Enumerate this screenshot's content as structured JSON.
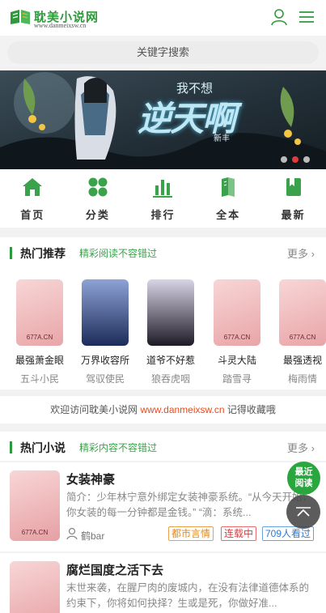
{
  "header": {
    "logo_title": "耽美小说网",
    "logo_url": "www.danmeixsw.cn",
    "user_icon": "user-icon",
    "menu_icon": "menu-icon"
  },
  "search": {
    "placeholder": "关键字搜索"
  },
  "banner": {
    "title": "逆天啊",
    "subtitle": "我不想",
    "tag": "新丰",
    "slide_count": 3,
    "active_slide": 2
  },
  "nav": [
    {
      "label": "首页",
      "icon": "home-icon"
    },
    {
      "label": "分类",
      "icon": "grid-icon"
    },
    {
      "label": "排行",
      "icon": "bar-chart-icon"
    },
    {
      "label": "全本",
      "icon": "book-stack-icon"
    },
    {
      "label": "最新",
      "icon": "bookmark-icon"
    }
  ],
  "hot_recommend": {
    "title": "热门推荐",
    "subtitle": "精彩阅读不容错过",
    "more": "更多",
    "books": [
      {
        "name": "最强萧金眼",
        "author": "五斗小民",
        "cover_tag": "677A.CN"
      },
      {
        "name": "万界收容所",
        "author": "驾驭使民",
        "cover_tag": ""
      },
      {
        "name": "道爷不好惹",
        "author": "狼吞虎咽",
        "cover_tag": ""
      },
      {
        "name": "斗灵大陆",
        "author": "踏雪寻",
        "cover_tag": "677A.CN"
      },
      {
        "name": "最强透视",
        "author": "梅雨情",
        "cover_tag": "677A.CN"
      }
    ]
  },
  "welcome": {
    "prefix": "欢迎访问耽美小说网",
    "url": "www.danmeixsw.cn",
    "suffix": "记得收藏哦"
  },
  "hot_novels": {
    "title": "热门小说",
    "subtitle": "精彩内容不容错过",
    "more": "更多",
    "items": [
      {
        "title": "女装神豪",
        "desc": "简介：少年林宁意外绑定女装神豪系统。“从今天开始，你女装的每一分钟都是金钱。” “滴：系统...",
        "author": "鹤bar",
        "category": "都市言情",
        "status": "连载中",
        "views": "709人看过",
        "cover_tag": "677A.CN"
      },
      {
        "title": "腐烂国度之活下去",
        "desc": "末世来袭，在腥尸肉的废城内，在没有法律道德体系的约束下，你将如何抉择？生或是死，你做好准...",
        "author": "",
        "category": "",
        "status": "",
        "views": "",
        "cover_tag": ""
      }
    ]
  },
  "floating": {
    "recent_line1": "最近",
    "recent_line2": "阅读",
    "top_icon": "chevron-up-icon"
  },
  "colors": {
    "accent": "#2e9a3b",
    "link": "#e74c1e"
  }
}
